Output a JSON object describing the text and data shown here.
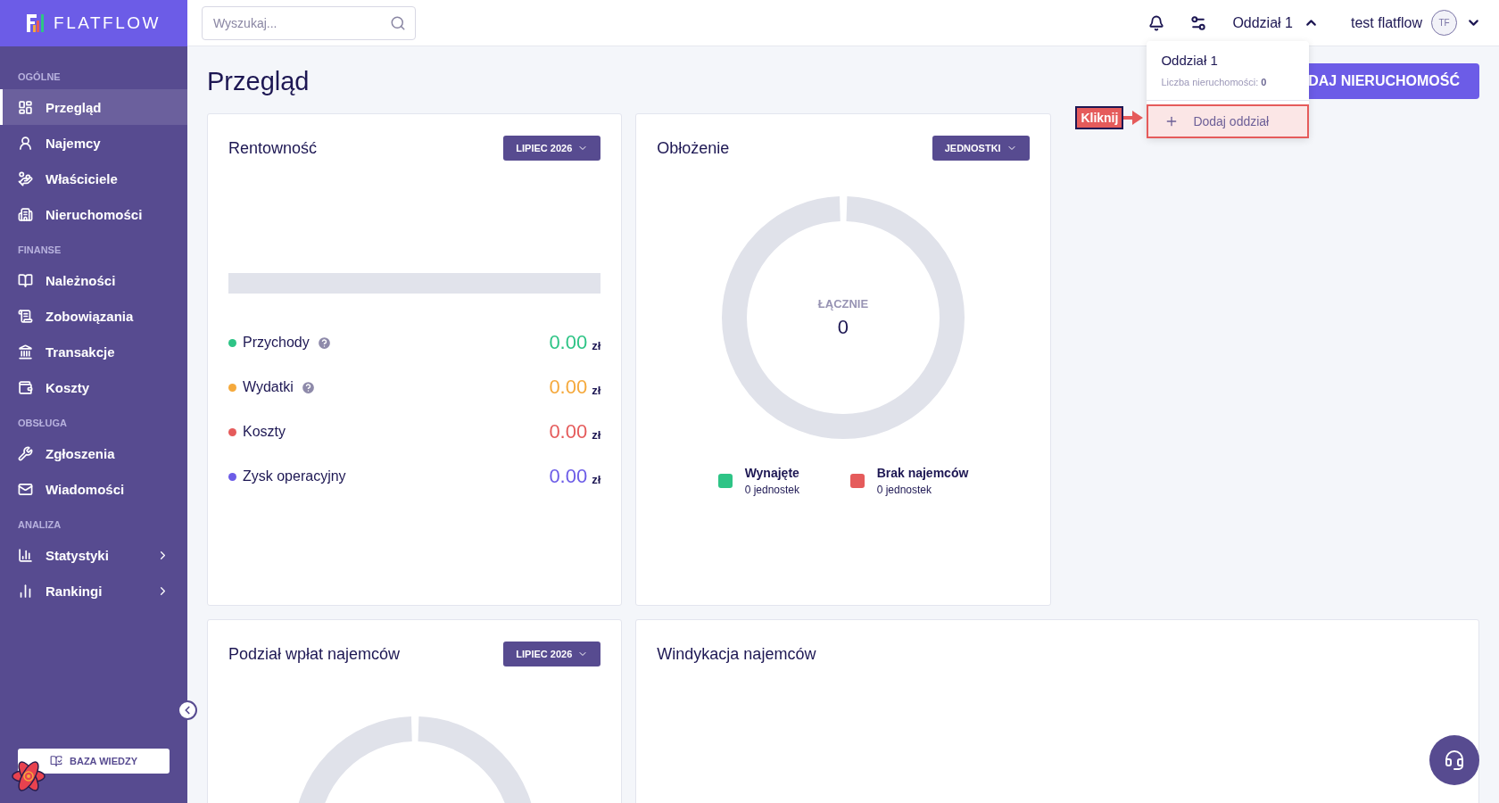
{
  "brand": {
    "name": "FLATFLOW"
  },
  "sidebar": {
    "sections": [
      {
        "title": "OGÓLNE",
        "items": [
          {
            "label": "Przegląd",
            "selected": true
          },
          {
            "label": "Najemcy",
            "selected": false
          },
          {
            "label": "Właściciele",
            "selected": false
          },
          {
            "label": "Nieruchomości",
            "selected": false
          }
        ]
      },
      {
        "title": "FINANSE",
        "items": [
          {
            "label": "Należności",
            "selected": false
          },
          {
            "label": "Zobowiązania",
            "selected": false
          },
          {
            "label": "Transakcje",
            "selected": false
          },
          {
            "label": "Koszty",
            "selected": false
          }
        ]
      },
      {
        "title": "OBSŁUGA",
        "items": [
          {
            "label": "Zgłoszenia",
            "selected": false
          },
          {
            "label": "Wiadomości",
            "selected": false
          }
        ]
      },
      {
        "title": "ANALIZA",
        "items": [
          {
            "label": "Statystyki",
            "selected": false,
            "expanded": false
          },
          {
            "label": "Rankingi",
            "selected": false,
            "expanded": false
          }
        ]
      }
    ],
    "knowledge_button": "BAZA WIEDZY"
  },
  "header": {
    "search": {
      "placeholder": "Wyszukaj..."
    },
    "branch": {
      "label": "Oddział 1",
      "expanded": true
    },
    "user": {
      "name": "test flatflow",
      "initials": "TF"
    }
  },
  "branch_menu": {
    "title": "Oddział 1",
    "subtitle": "Liczba nieruchomości: **0**",
    "items": [
      {
        "label": "Dodaj oddział",
        "selected": true
      }
    ],
    "annotation": "Kliknij"
  },
  "page": {
    "title": "Przegląd",
    "action_button": "DAJ NIERUCHOMOŚĆ"
  },
  "profitability": {
    "title": "Rentowność",
    "period": "LIPIEC 2026",
    "metrics": [
      {
        "label": "Przychody",
        "value": "0.00",
        "currency": "zł",
        "color": "#2ec486",
        "help": true
      },
      {
        "label": "Wydatki",
        "value": "0.00",
        "currency": "zł",
        "color": "#f5a93c",
        "help": true
      },
      {
        "label": "Koszty",
        "value": "0.00",
        "currency": "zł",
        "color": "#e55b5b"
      },
      {
        "label": "Zysk operacyjny",
        "value": "0.00",
        "currency": "zł",
        "color": "#6c5ce7"
      }
    ]
  },
  "occupancy": {
    "title": "Obłożenie",
    "filter": "JEDNOSTKI",
    "total_label": "ŁĄCZNIE",
    "total": "0",
    "legend": [
      {
        "label": "Wynajęte",
        "sub": "0 jednostek",
        "color": "#2ec486"
      },
      {
        "label": "Brak najemców",
        "sub": "0 jednostek",
        "color": "#e55b5b"
      }
    ]
  },
  "payments": {
    "title": "Podział wpłat najemców",
    "period": "LIPIEC 2026"
  },
  "collections": {
    "title": "Windykacja najemców"
  }
}
